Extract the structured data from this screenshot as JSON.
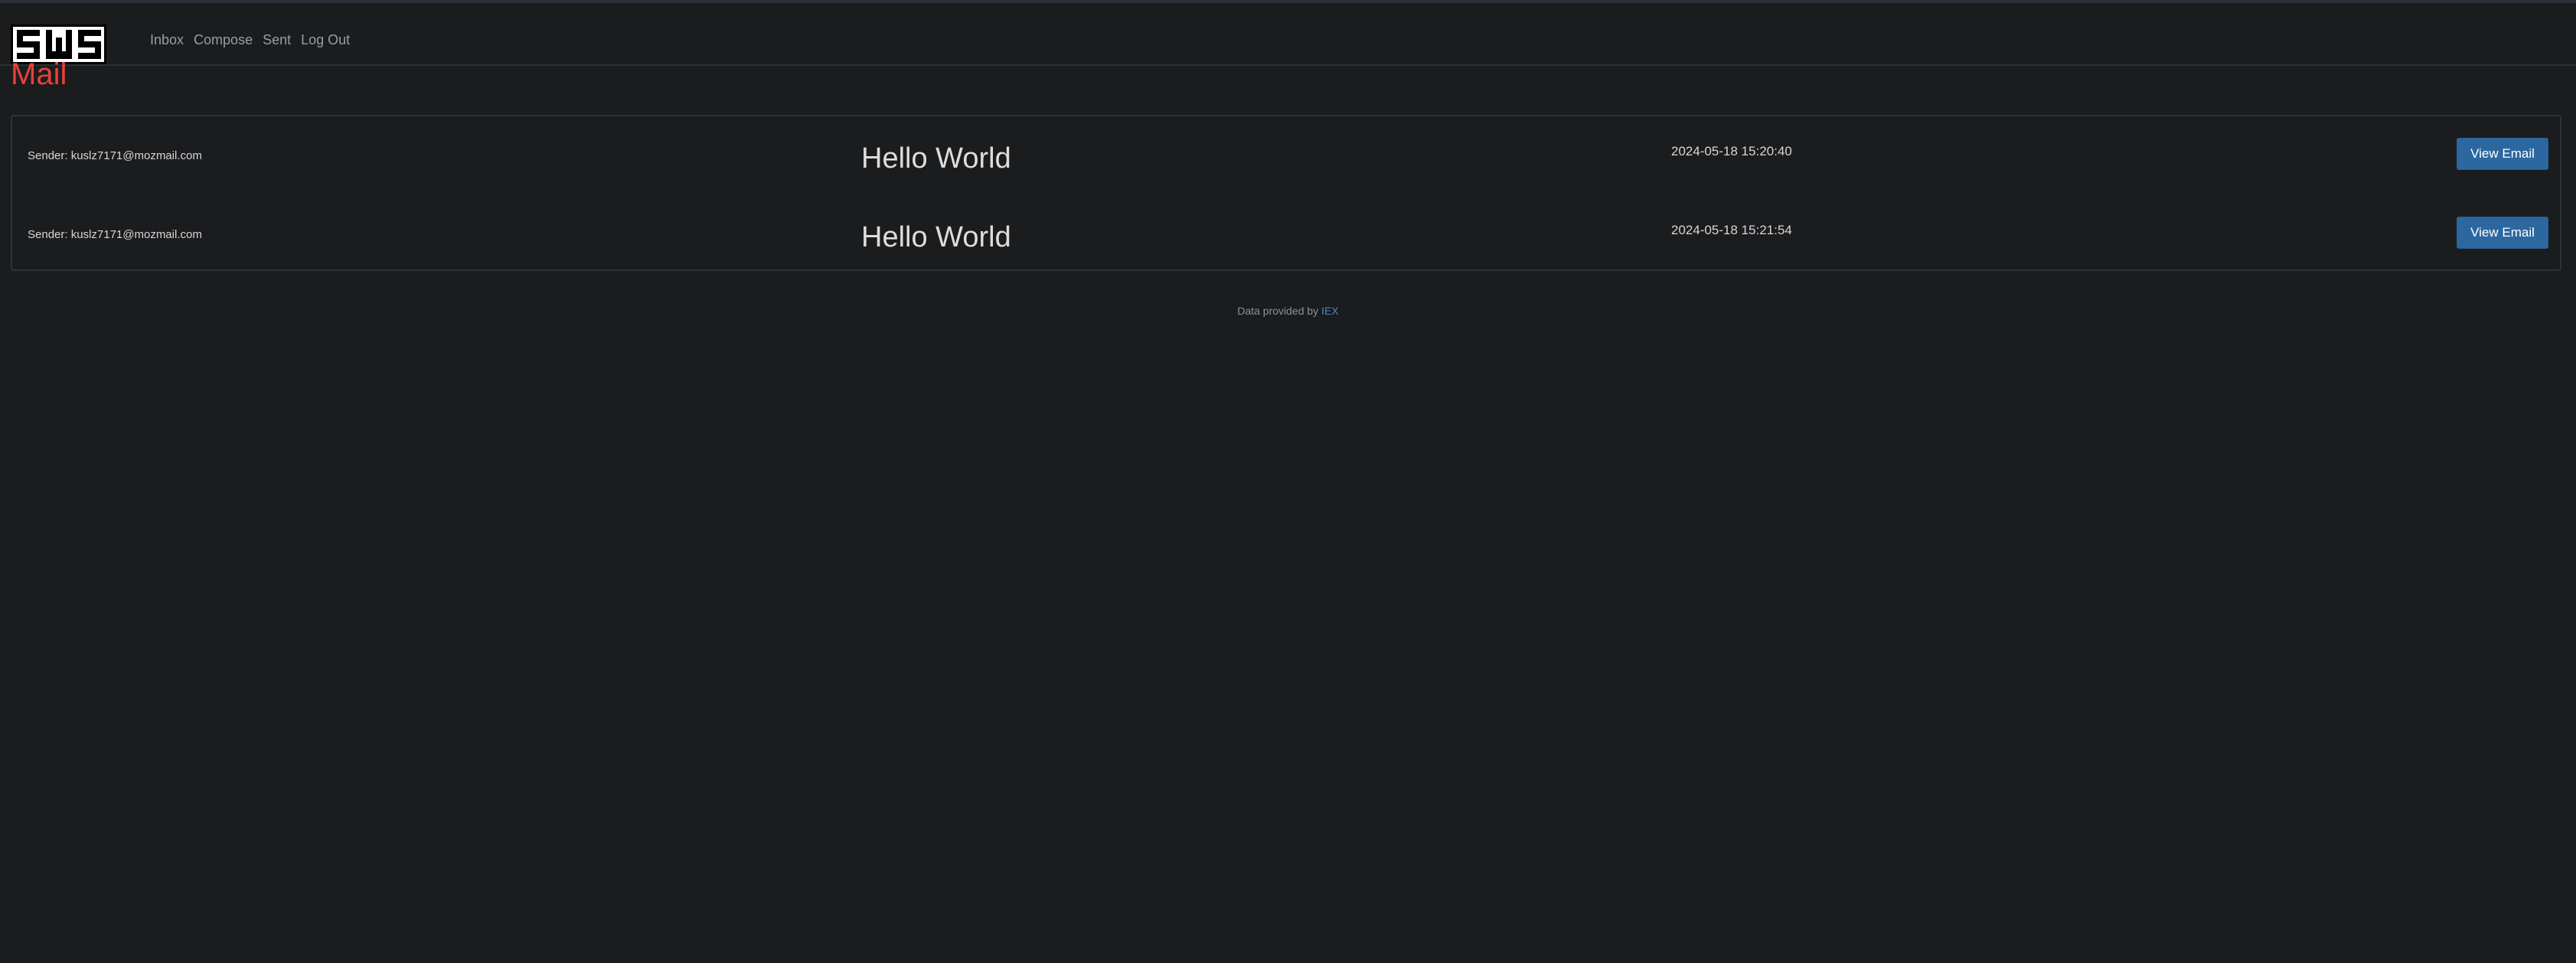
{
  "logo": {
    "text": "SWS"
  },
  "nav": {
    "items": [
      {
        "label": "Inbox"
      },
      {
        "label": "Compose"
      },
      {
        "label": "Sent"
      },
      {
        "label": "Log Out"
      }
    ]
  },
  "page": {
    "title": "Mail"
  },
  "emails": [
    {
      "sender": "Sender: kuslz7171@mozmail.com",
      "subject": "Hello World",
      "timestamp": "2024-05-18 15:20:40",
      "button_label": "View Email"
    },
    {
      "sender": "Sender: kuslz7171@mozmail.com",
      "subject": "Hello World",
      "timestamp": "2024-05-18 15:21:54",
      "button_label": "View Email"
    }
  ],
  "footer": {
    "text": "Data provided by ",
    "link_label": "IEX"
  },
  "colors": {
    "background": "#1b1c1e",
    "title_red": "#e8413b",
    "button_blue": "#2d67a0",
    "link_blue": "#4f86c6"
  }
}
